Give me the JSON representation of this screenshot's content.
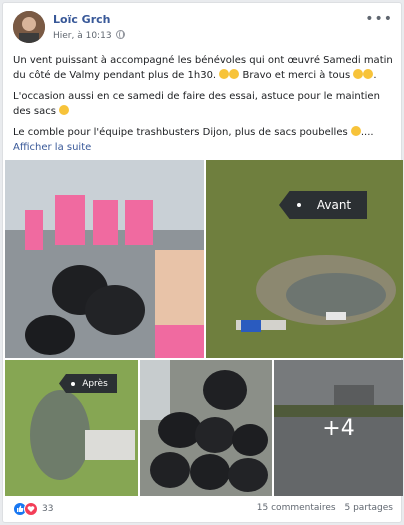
{
  "post": {
    "author": "Loïc Grch",
    "timestamp": "Hier, à 10:13",
    "more_glyph": "•••",
    "paragraph1_a": "Un vent puissant à accompagné les bénévoles qui ont œuvré Samedi matin du côté de Valmy pendant plus de 1h30.",
    "paragraph1_b": "Bravo et merci à tous",
    "paragraph1_c": ".",
    "paragraph2": "L'occasion aussi en ce samedi de faire des essai, astuce pour le maintien des sacs",
    "paragraph3": "Le comble pour l'équipe trashbusters Dijon, plus de sacs poubelles",
    "paragraph3_end": "....",
    "see_more": "Afficher la suite"
  },
  "photos": {
    "sign_before": "Avant",
    "sign_after": "Après",
    "extra_count": "+4"
  },
  "footer": {
    "reaction_count": "33",
    "comments": "15 commentaires",
    "shares": "5 partages"
  },
  "icons": [
    "globe-icon",
    "more-icon",
    "muscle-emoji",
    "thumbs-up-emoji",
    "smirk-emoji",
    "like-reaction-icon",
    "love-reaction-icon"
  ],
  "colors": {
    "link": "#385898",
    "like": "#1877f2",
    "love": "#f33e58"
  }
}
